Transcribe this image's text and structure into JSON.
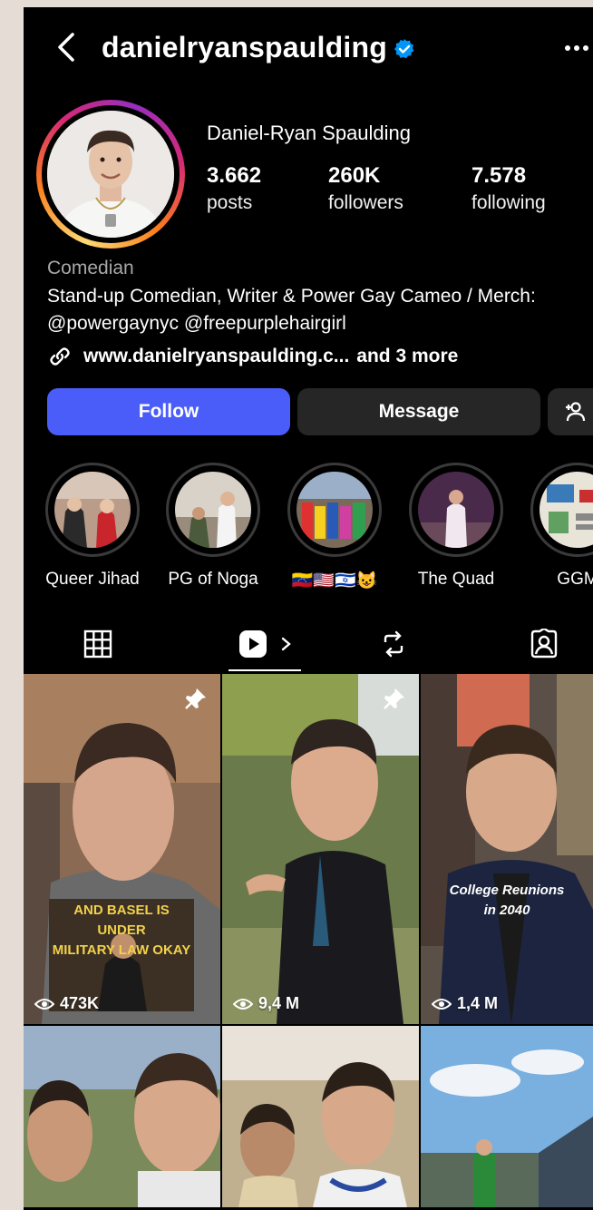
{
  "header": {
    "username": "danielryanspaulding",
    "verified": true,
    "back_icon": "chevron-left-icon",
    "more_icon": "more-horizontal-icon"
  },
  "profile": {
    "full_name": "Daniel-Ryan Spaulding",
    "stats": [
      {
        "value": "3.662",
        "label": "posts"
      },
      {
        "value": "260K",
        "label": "followers"
      },
      {
        "value": "7.578",
        "label": "following"
      }
    ],
    "category": "Comedian",
    "bio_line1": "Stand-up Comedian, Writer & Power Gay Cameo / Merch:",
    "bio_line2": "@powergaynyc @freepurplehairgirl",
    "link_url": "www.danielryanspaulding.c...",
    "link_more": "and 3 more"
  },
  "actions": {
    "follow_label": "Follow",
    "message_label": "Message",
    "add_icon": "add-person-icon"
  },
  "highlights": [
    {
      "label": "Queer Jihad"
    },
    {
      "label": "PG of Noga"
    },
    {
      "label": "🇻🇪🇺🇸🇮🇱😺"
    },
    {
      "label": "The Quad"
    },
    {
      "label": "GGM"
    }
  ],
  "tabs": [
    {
      "name": "grid",
      "icon": "grid-icon"
    },
    {
      "name": "reels",
      "icon": "reels-icon",
      "active": true
    },
    {
      "name": "reposts",
      "icon": "repost-icon"
    },
    {
      "name": "tagged",
      "icon": "tagged-icon"
    }
  ],
  "posts": [
    {
      "views": "473K",
      "pinned": true,
      "overlay_text_1": "AND BASEL IS UNDER",
      "overlay_text_2": "MILITARY LAW OKAY"
    },
    {
      "views": "9,4 M",
      "pinned": true
    },
    {
      "views": "1,4 M",
      "pinned": false,
      "overlay_text_1": "College Reunions",
      "overlay_text_2": "in 2040"
    },
    {
      "views": "",
      "pinned": false
    },
    {
      "views": "",
      "pinned": false
    },
    {
      "views": "",
      "pinned": false
    }
  ],
  "colors": {
    "background": "#000000",
    "follow_button": "#4a5df9",
    "secondary_button": "#262626",
    "verified_badge": "#0095f6",
    "muted_text": "#a8a8a8"
  }
}
